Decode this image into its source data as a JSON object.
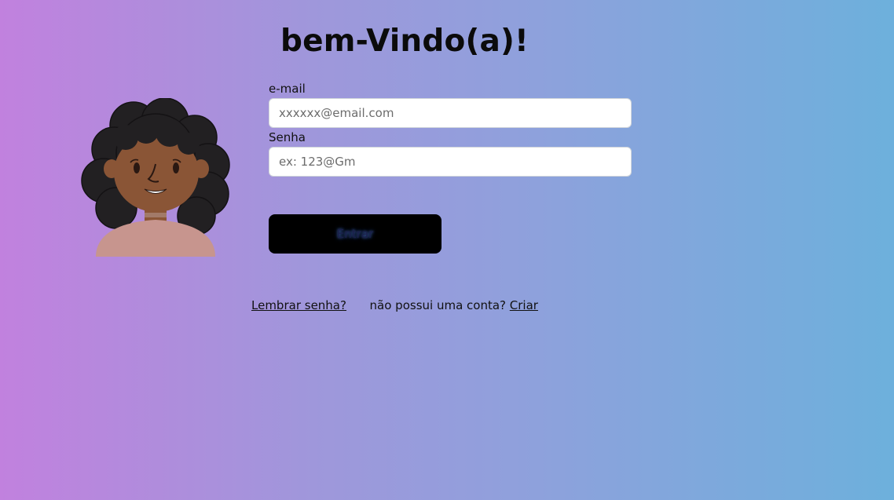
{
  "header": {
    "title": "bem-Vindo(a)!"
  },
  "form": {
    "email_label": "e-mail",
    "email_placeholder": "xxxxxx@email.com",
    "email_value": "",
    "password_label": "Senha",
    "password_placeholder": "ex: 123@Gm",
    "password_value": "",
    "submit_label": "Entrar"
  },
  "links": {
    "remember_password": "Lembrar senha?",
    "no_account_text": "não possui uma conta?",
    "create_account": "Criar"
  },
  "colors": {
    "gradient_start": "#c181de",
    "gradient_end": "#6db0dc",
    "button_bg": "#000000"
  },
  "icons": {
    "avatar": "woman-avatar-illustration"
  }
}
